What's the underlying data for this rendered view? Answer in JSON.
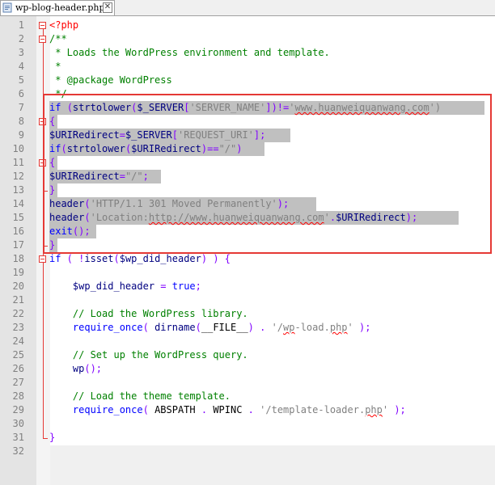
{
  "tab": {
    "title": "wp-blog-header.php",
    "close_icon": "close-icon"
  },
  "line_numbers": [
    "1",
    "2",
    "3",
    "4",
    "5",
    "6",
    "7",
    "8",
    "9",
    "10",
    "11",
    "12",
    "13",
    "14",
    "15",
    "16",
    "17",
    "18",
    "19",
    "20",
    "21",
    "22",
    "23",
    "24",
    "25",
    "26",
    "27",
    "28",
    "29",
    "30",
    "31",
    "32"
  ],
  "code_lines": [
    [
      {
        "t": "<?php",
        "c": "php"
      }
    ],
    [
      {
        "t": "/**",
        "c": "cm"
      }
    ],
    [
      {
        "t": " * Loads the WordPress environment and template.",
        "c": "cm"
      }
    ],
    [
      {
        "t": " *",
        "c": "cm"
      }
    ],
    [
      {
        "t": " * @package WordPress",
        "c": "cm"
      }
    ],
    [
      {
        "t": " */",
        "c": "cm"
      }
    ],
    [
      {
        "t": "if",
        "c": "kw"
      },
      {
        "t": " ",
        "c": ""
      },
      {
        "t": "(",
        "c": "op"
      },
      {
        "t": "strtolower",
        "c": "fn"
      },
      {
        "t": "(",
        "c": "op"
      },
      {
        "t": "$_SERVER",
        "c": "var"
      },
      {
        "t": "[",
        "c": "op"
      },
      {
        "t": "'SERVER_NAME'",
        "c": "str"
      },
      {
        "t": "])!=",
        "c": "op"
      },
      {
        "t": "'",
        "c": "str"
      },
      {
        "t": "www.huanweiquanwang.com",
        "c": "str sq"
      },
      {
        "t": "')",
        "c": "str"
      }
    ],
    [
      {
        "t": "{",
        "c": "op"
      }
    ],
    [
      {
        "t": "$URIRedirect",
        "c": "var"
      },
      {
        "t": "=",
        "c": "op"
      },
      {
        "t": "$_SERVER",
        "c": "var"
      },
      {
        "t": "[",
        "c": "op"
      },
      {
        "t": "'REQUEST_URI'",
        "c": "str"
      },
      {
        "t": "];",
        "c": "op"
      }
    ],
    [
      {
        "t": "if",
        "c": "kw"
      },
      {
        "t": "(",
        "c": "op"
      },
      {
        "t": "strtolower",
        "c": "fn"
      },
      {
        "t": "(",
        "c": "op"
      },
      {
        "t": "$URIRedirect",
        "c": "var"
      },
      {
        "t": ")==",
        "c": "op"
      },
      {
        "t": "\"/\"",
        "c": "str"
      },
      {
        "t": ")",
        "c": "op"
      }
    ],
    [
      {
        "t": "{",
        "c": "op"
      }
    ],
    [
      {
        "t": "$URIRedirect",
        "c": "var"
      },
      {
        "t": "=",
        "c": "op"
      },
      {
        "t": "\"/\"",
        "c": "str"
      },
      {
        "t": ";",
        "c": "op"
      }
    ],
    [
      {
        "t": "}",
        "c": "op"
      }
    ],
    [
      {
        "t": "header",
        "c": "fn"
      },
      {
        "t": "(",
        "c": "op"
      },
      {
        "t": "'HTTP/1.1 301 Moved Permanently'",
        "c": "str"
      },
      {
        "t": ");",
        "c": "op"
      }
    ],
    [
      {
        "t": "header",
        "c": "fn"
      },
      {
        "t": "(",
        "c": "op"
      },
      {
        "t": "'Location:",
        "c": "str"
      },
      {
        "t": "http://www.huanweiquanwang.com",
        "c": "str sq"
      },
      {
        "t": "'",
        "c": "str"
      },
      {
        "t": ".",
        "c": "op"
      },
      {
        "t": "$URIRedirect",
        "c": "var"
      },
      {
        "t": ");",
        "c": "op"
      }
    ],
    [
      {
        "t": "exit",
        "c": "kw"
      },
      {
        "t": "();",
        "c": "op"
      }
    ],
    [
      {
        "t": "}",
        "c": "op"
      }
    ],
    [
      {
        "t": "if",
        "c": "kw"
      },
      {
        "t": " ( ",
        "c": "op"
      },
      {
        "t": "!",
        "c": "op"
      },
      {
        "t": "isset",
        "c": "fn"
      },
      {
        "t": "(",
        "c": "op"
      },
      {
        "t": "$wp_did_header",
        "c": "var"
      },
      {
        "t": ") ) {",
        "c": "op"
      }
    ],
    [],
    [
      {
        "t": "    ",
        "c": ""
      },
      {
        "t": "$wp_did_header",
        "c": "var"
      },
      {
        "t": " = ",
        "c": "op"
      },
      {
        "t": "true",
        "c": "kw"
      },
      {
        "t": ";",
        "c": "op"
      }
    ],
    [],
    [
      {
        "t": "    ",
        "c": ""
      },
      {
        "t": "// Load the WordPress library.",
        "c": "cm"
      }
    ],
    [
      {
        "t": "    ",
        "c": ""
      },
      {
        "t": "require_once",
        "c": "kw"
      },
      {
        "t": "( ",
        "c": "op"
      },
      {
        "t": "dirname",
        "c": "fn"
      },
      {
        "t": "(",
        "c": "op"
      },
      {
        "t": "__FILE__",
        "c": ""
      },
      {
        "t": ") . ",
        "c": "op"
      },
      {
        "t": "'/",
        "c": "str"
      },
      {
        "t": "wp",
        "c": "str sq"
      },
      {
        "t": "-load.",
        "c": "str"
      },
      {
        "t": "php",
        "c": "str sq"
      },
      {
        "t": "'",
        "c": "str"
      },
      {
        "t": " );",
        "c": "op"
      }
    ],
    [],
    [
      {
        "t": "    ",
        "c": ""
      },
      {
        "t": "// Set up the WordPress query.",
        "c": "cm"
      }
    ],
    [
      {
        "t": "    ",
        "c": ""
      },
      {
        "t": "wp",
        "c": "fn"
      },
      {
        "t": "();",
        "c": "op"
      }
    ],
    [],
    [
      {
        "t": "    ",
        "c": ""
      },
      {
        "t": "// Load the theme template.",
        "c": "cm"
      }
    ],
    [
      {
        "t": "    ",
        "c": ""
      },
      {
        "t": "require_once",
        "c": "kw"
      },
      {
        "t": "( ",
        "c": "op"
      },
      {
        "t": "ABSPATH",
        "c": ""
      },
      {
        "t": " . ",
        "c": "op"
      },
      {
        "t": "WPINC",
        "c": ""
      },
      {
        "t": " . ",
        "c": "op"
      },
      {
        "t": "'/template-loader.",
        "c": "str"
      },
      {
        "t": "php",
        "c": "str sq"
      },
      {
        "t": "'",
        "c": "str"
      },
      {
        "t": " );",
        "c": "op"
      }
    ],
    [],
    [
      {
        "t": "}",
        "c": "op"
      }
    ],
    []
  ],
  "selected_lines": [
    7,
    8,
    9,
    10,
    11,
    12,
    13,
    14,
    15,
    16,
    17
  ],
  "highlight_color": "#e53935"
}
